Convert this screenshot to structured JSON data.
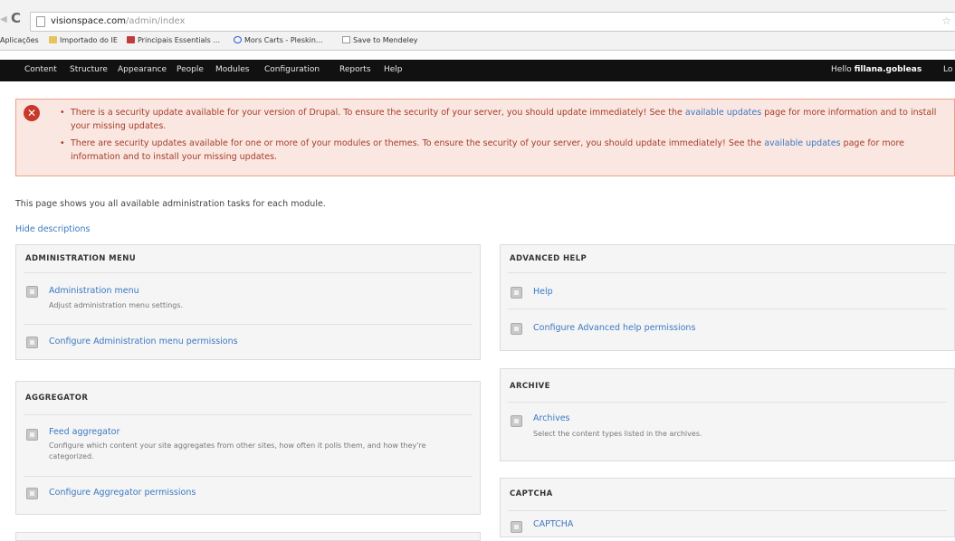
{
  "browser": {
    "url_host": "visionspace.com",
    "url_path": "/admin/index",
    "bookmarks": [
      "Aplicações",
      "Importado do IE",
      "Principais Essentials ...",
      "Mors Carts - Pleskin...",
      "Save to Mendeley"
    ]
  },
  "toolbar": {
    "menu": [
      "Content",
      "Structure",
      "Appearance",
      "People",
      "Modules",
      "Configuration",
      "Reports",
      "Help"
    ],
    "hello_prefix": "Hello",
    "username": "fillana.gobleas",
    "logout": "Lo"
  },
  "messages": {
    "icon": "error-x-icon",
    "items": [
      {
        "text": "There is a security update available for your version of Drupal. To ensure the security of your server, you should update immediately! See the",
        "link": "available updates",
        "tail": "page for more information and to install your missing updates."
      },
      {
        "text": "There are security updates available for one or more of your modules or themes. To ensure the security of your server, you should update immediately! See the",
        "link": "available updates",
        "tail": "page for more information and to install your missing updates."
      }
    ]
  },
  "intro": "This page shows you all available administration tasks for each module.",
  "hide_descriptions": "Hide descriptions",
  "panels": {
    "admin_menu": {
      "title": "ADMINISTRATION MENU",
      "entries": [
        {
          "label": "Administration menu",
          "desc": "Adjust administration menu settings."
        },
        {
          "label": "Configure Administration menu permissions"
        }
      ]
    },
    "aggregator": {
      "title": "AGGREGATOR",
      "entries": [
        {
          "label": "Feed aggregator",
          "desc": "Configure which content your site aggregates from other sites, how often it polls them, and how they're categorized."
        },
        {
          "label": "Configure Aggregator permissions"
        }
      ]
    },
    "advanced_help": {
      "title": "ADVANCED HELP",
      "entries": [
        {
          "label": "Help"
        },
        {
          "label": "Configure Advanced help permissions"
        }
      ]
    },
    "archive": {
      "title": "ARCHIVE",
      "entries": [
        {
          "label": "Archives",
          "desc": "Select the content types listed in the archives."
        }
      ]
    },
    "captcha": {
      "title": "CAPTCHA",
      "entries": [
        {
          "label": "CAPTCHA"
        }
      ]
    }
  }
}
